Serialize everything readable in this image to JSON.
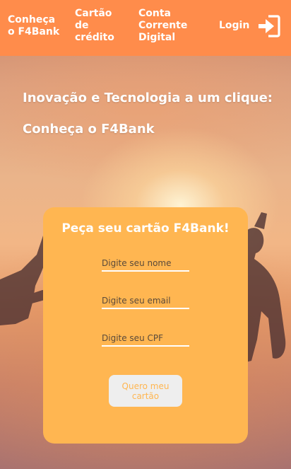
{
  "nav": {
    "links": [
      {
        "label": "Conheça\no F4Bank"
      },
      {
        "label": "Cartão\nde\ncrédito"
      },
      {
        "label": "Conta\nCorrente\nDigital"
      }
    ],
    "login_label": "Login",
    "login_icon": "sign-in-icon"
  },
  "hero": {
    "headline": "Inovação e Tecnologia a um clique:",
    "subheadline": "Conheça o F4Bank"
  },
  "form": {
    "title": "Peça seu cartão F4Bank!",
    "name_placeholder": "Digite seu nome",
    "email_placeholder": "Digite seu email",
    "cpf_placeholder": "Digite seu CPF",
    "submit_label": "Quero meu cartão"
  },
  "colors": {
    "navbar": "#ff8c4b",
    "card": "#ffb651",
    "button_bg": "#eeeeee",
    "button_text": "#ffb651"
  }
}
